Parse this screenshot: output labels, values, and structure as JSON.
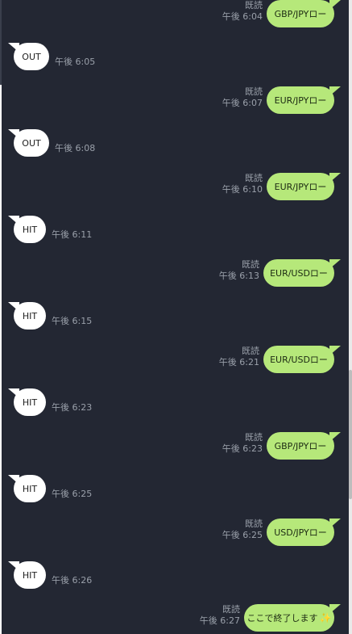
{
  "messages": [
    {
      "side": "out",
      "text": "GBP/JPYロー",
      "read": "既読",
      "time": "午後 6:04"
    },
    {
      "side": "in",
      "text": "OUT",
      "time": "午後 6:05"
    },
    {
      "side": "out",
      "text": "EUR/JPYロー",
      "read": "既読",
      "time": "午後 6:07"
    },
    {
      "side": "in",
      "text": "OUT",
      "time": "午後 6:08"
    },
    {
      "side": "out",
      "text": "EUR/JPYロー",
      "read": "既読",
      "time": "午後 6:10"
    },
    {
      "side": "in",
      "text": "HIT",
      "time": "午後 6:11"
    },
    {
      "side": "out",
      "text": "EUR/USDロー",
      "read": "既読",
      "time": "午後 6:13"
    },
    {
      "side": "in",
      "text": "HIT",
      "time": "午後 6:15"
    },
    {
      "side": "out",
      "text": "EUR/USDロー",
      "read": "既読",
      "time": "午後 6:21"
    },
    {
      "side": "in",
      "text": "HIT",
      "time": "午後 6:23"
    },
    {
      "side": "out",
      "text": "GBP/JPYロー",
      "read": "既読",
      "time": "午後 6:23"
    },
    {
      "side": "in",
      "text": "HIT",
      "time": "午後 6:25"
    },
    {
      "side": "out",
      "text": "USD/JPYロー",
      "read": "既読",
      "time": "午後 6:25"
    },
    {
      "side": "in",
      "text": "HIT",
      "time": "午後 6:26"
    },
    {
      "side": "out",
      "text": "ここで終了します",
      "emoji": "✨",
      "read": "既読",
      "time": "午後 6:27"
    }
  ],
  "colors": {
    "background": "#232733",
    "incoming": "#ffffff",
    "outgoing": "#b6e87a",
    "meta": "#9aa0aa"
  }
}
